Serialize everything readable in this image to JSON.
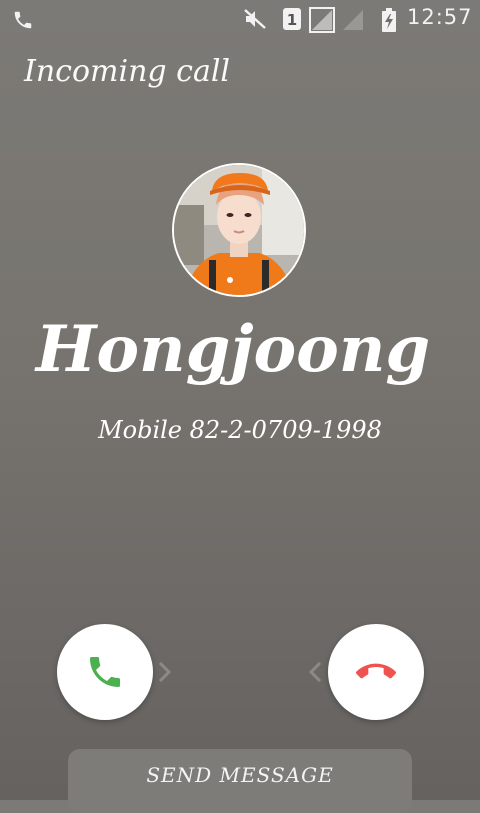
{
  "status_bar": {
    "time": "12:57",
    "sim_slot": "1",
    "icons": [
      "phone-icon",
      "mute-icon",
      "sim-icon",
      "signal-icon",
      "signal-icon",
      "battery-charging-icon"
    ]
  },
  "call": {
    "title": "Incoming call",
    "caller_name": "Hongjoong",
    "caller_number": "Mobile 82-2-0709-1998"
  },
  "actions": {
    "answer_icon": "phone-icon",
    "decline_icon": "phone-hangup-icon",
    "send_message_label": "SEND MESSAGE"
  },
  "colors": {
    "answer": "#4caf50",
    "decline": "#ef5350",
    "background": "#77746f"
  }
}
